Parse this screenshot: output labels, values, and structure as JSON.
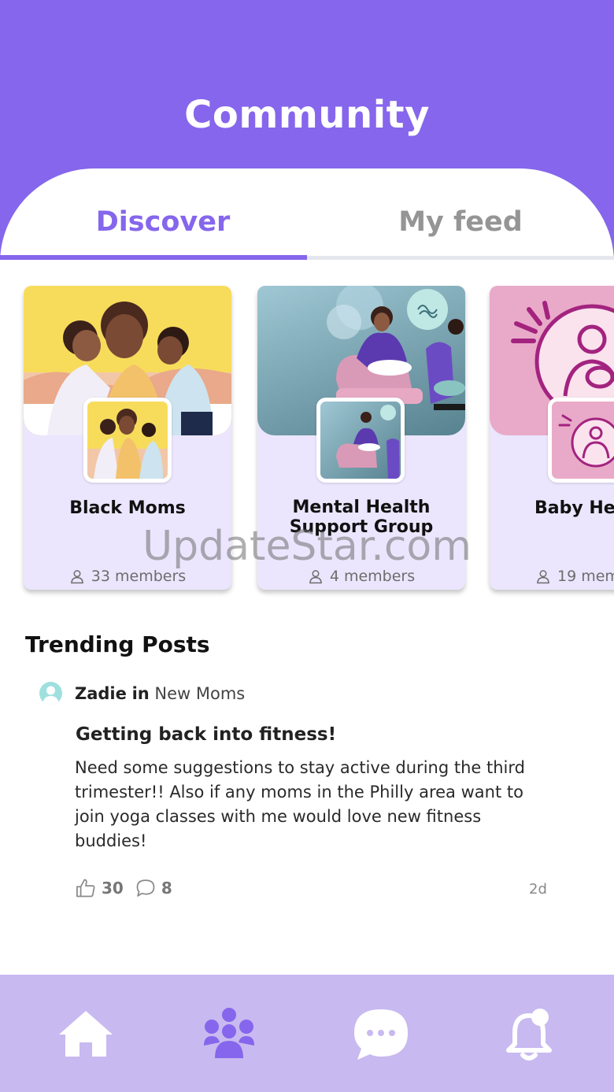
{
  "header": {
    "title": "Community"
  },
  "tabs": [
    {
      "label": "Discover",
      "active": true
    },
    {
      "label": "My feed",
      "active": false
    }
  ],
  "groups": [
    {
      "name": "Black Moms",
      "members": "33 members",
      "icon": "user-icon"
    },
    {
      "name": "Mental Health Support Group",
      "name_line1": "Mental Health",
      "name_line2": "Support Group",
      "members": "4 members",
      "icon": "user-icon"
    },
    {
      "name": "Baby He",
      "members": "19 mem",
      "icon": "user-icon"
    }
  ],
  "trending": {
    "title": "Trending Posts",
    "post": {
      "author": "Zadie",
      "in_word": "in",
      "group": "New Moms",
      "title": "Getting back into fitness!",
      "body": "Need some suggestions to stay active during the third trimester!! Also if any moms in the Philly area want to join yoga classes with me would love new fitness buddies!",
      "likes": "30",
      "comments": "8",
      "age": "2d"
    }
  },
  "bottom_nav": [
    {
      "icon": "home-icon"
    },
    {
      "icon": "community-icon"
    },
    {
      "icon": "chat-icon"
    },
    {
      "icon": "notification-bell-icon"
    }
  ],
  "watermark": "UpdateStar.com",
  "colors": {
    "accent": "#8566ec",
    "nav_background": "#c8b9f0",
    "card_background": "#ebe6fd"
  }
}
